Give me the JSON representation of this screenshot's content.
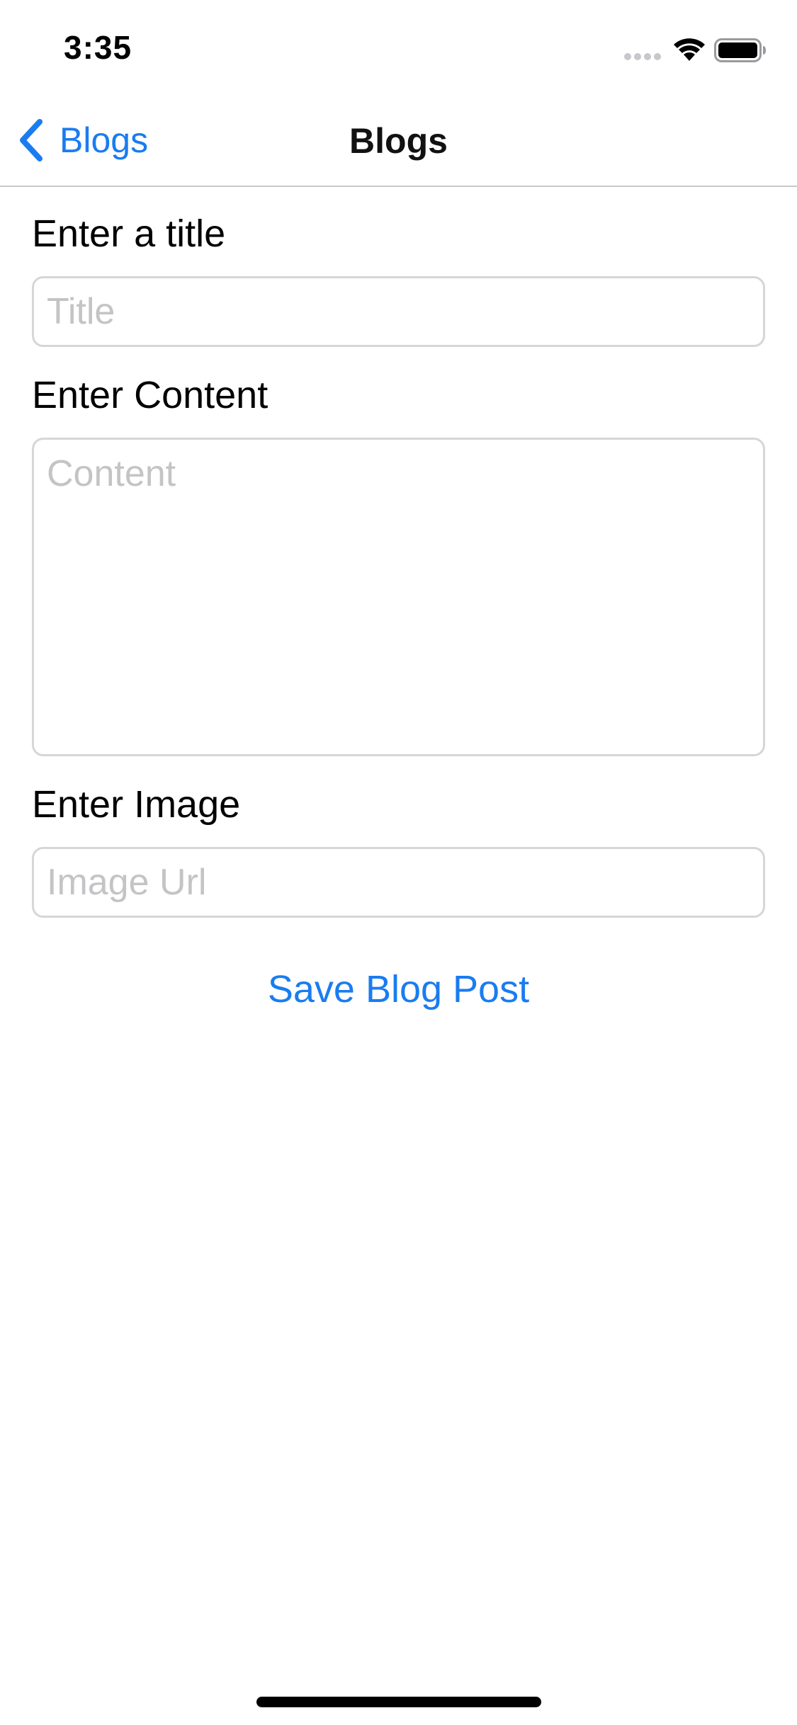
{
  "status_bar": {
    "time": "3:35",
    "icons": [
      "cellular-signal-icon",
      "wifi-icon",
      "battery-icon"
    ]
  },
  "nav": {
    "back_label": "Blogs",
    "title": "Blogs"
  },
  "form": {
    "title_label": "Enter a title",
    "title_placeholder": "Title",
    "title_value": "",
    "content_label": "Enter Content",
    "content_placeholder": "Content",
    "content_value": "",
    "image_label": "Enter Image",
    "image_placeholder": "Image Url",
    "image_value": "",
    "save_label": "Save Blog Post"
  },
  "colors": {
    "accent": "#1a7cf0",
    "placeholder": "#c4c4c6",
    "border": "#d6d6d6"
  }
}
